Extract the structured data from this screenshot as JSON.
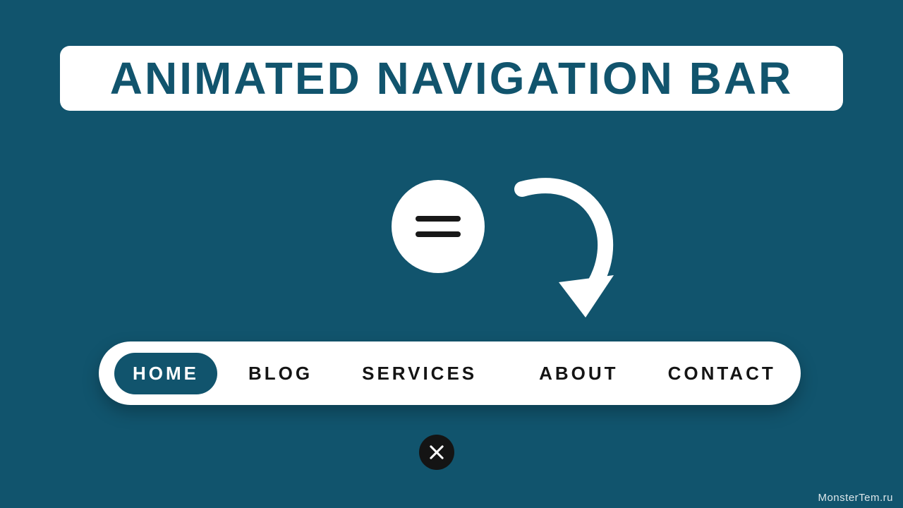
{
  "title": "ANIMATED NAVIGATION BAR",
  "nav": {
    "items": [
      {
        "label": "HOME",
        "active": true
      },
      {
        "label": "BLOG",
        "active": false
      },
      {
        "label": "SERVICES",
        "active": false
      },
      {
        "label": "ABOUT",
        "active": false
      },
      {
        "label": "CONTACT",
        "active": false
      }
    ]
  },
  "icons": {
    "hamburger": "hamburger-icon",
    "arrow": "curved-arrow-icon",
    "close": "close-icon"
  },
  "watermark": "MonsterTem.ru",
  "colors": {
    "background": "#11546d",
    "surface": "#ffffff",
    "text_dark": "#141414"
  }
}
